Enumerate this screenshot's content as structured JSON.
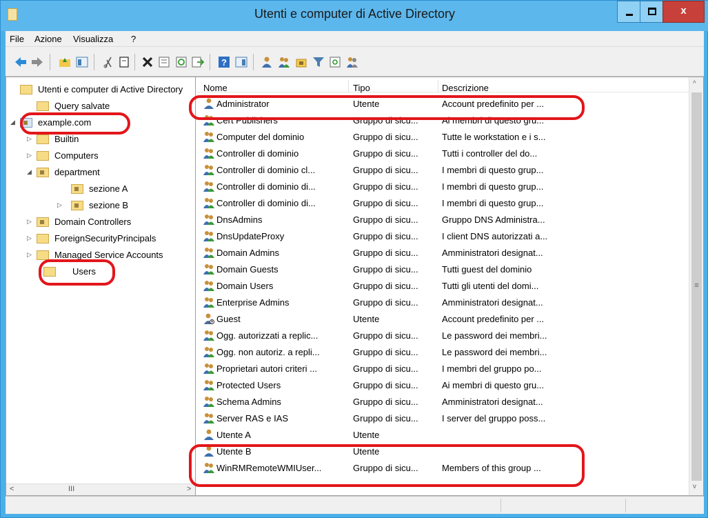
{
  "window": {
    "title": "Utenti e computer di Active Directory",
    "close_glyph": "x"
  },
  "menu": [
    "File",
    "Azione",
    "Visualizza",
    "?"
  ],
  "toolbar_icons": [
    "back-icon",
    "forward-icon",
    "up-folder-icon",
    "show-tree-icon",
    "cut-icon",
    "copy-icon",
    "delete-icon",
    "properties-icon",
    "refresh-icon",
    "export-icon",
    "help-icon",
    "console-icon",
    "new-user-icon",
    "new-group-icon",
    "new-ou-icon",
    "filter-icon",
    "find-icon",
    "add-to-group-icon"
  ],
  "tree": [
    {
      "label": "Utenti e computer di Active Directory",
      "level": 0,
      "expander": ""
    },
    {
      "label": "Query salvate",
      "level": 1,
      "expander": ""
    },
    {
      "label": "example.com",
      "level": 0,
      "expander": "◢"
    },
    {
      "label": "Builtin",
      "level": 1,
      "expander": "▷"
    },
    {
      "label": "Computers",
      "level": 1,
      "expander": "▷"
    },
    {
      "label": "department",
      "level": 1,
      "expander": "◢"
    },
    {
      "label": "sezione A",
      "level": 2,
      "expander": ""
    },
    {
      "label": "sezione B",
      "level": 2,
      "expander": "▷"
    },
    {
      "label": "Domain Controllers",
      "level": 1,
      "expander": "▷"
    },
    {
      "label": "ForeignSecurityPrincipals",
      "level": 1,
      "expander": "▷"
    },
    {
      "label": "Managed Service Accounts",
      "level": 1,
      "expander": "▷"
    },
    {
      "label": "Users",
      "level": 1,
      "expander": ""
    }
  ],
  "tree_scroll": {
    "left": "<",
    "grip": "III",
    "right": ">"
  },
  "list": {
    "columns": [
      "Nome",
      "Tipo",
      "Descrizione"
    ],
    "rows": [
      {
        "name": "Administrator",
        "type": "Utente",
        "desc": "Account predefinito per ...",
        "icon": "user"
      },
      {
        "name": "Cert Publishers",
        "type": "Gruppo di sicu...",
        "desc": "Ai membri di questo gru...",
        "icon": "group"
      },
      {
        "name": "Computer del dominio",
        "type": "Gruppo di sicu...",
        "desc": "Tutte le workstation e i s...",
        "icon": "group"
      },
      {
        "name": "Controller di dominio",
        "type": "Gruppo di sicu...",
        "desc": "Tutti i controller del do...",
        "icon": "group"
      },
      {
        "name": "Controller di dominio cl...",
        "type": "Gruppo di sicu...",
        "desc": "I membri di questo grup...",
        "icon": "group"
      },
      {
        "name": "Controller di dominio di...",
        "type": "Gruppo di sicu...",
        "desc": "I membri di questo grup...",
        "icon": "group"
      },
      {
        "name": "Controller di dominio di...",
        "type": "Gruppo di sicu...",
        "desc": "I membri di questo grup...",
        "icon": "group"
      },
      {
        "name": "DnsAdmins",
        "type": "Gruppo di sicu...",
        "desc": "Gruppo DNS Administra...",
        "icon": "group"
      },
      {
        "name": "DnsUpdateProxy",
        "type": "Gruppo di sicu...",
        "desc": "I client DNS autorizzati a...",
        "icon": "group"
      },
      {
        "name": "Domain Admins",
        "type": "Gruppo di sicu...",
        "desc": "Amministratori designat...",
        "icon": "group"
      },
      {
        "name": "Domain Guests",
        "type": "Gruppo di sicu...",
        "desc": "Tutti guest del dominio",
        "icon": "group"
      },
      {
        "name": "Domain Users",
        "type": "Gruppo di sicu...",
        "desc": "Tutti gli utenti del domi...",
        "icon": "group"
      },
      {
        "name": "Enterprise Admins",
        "type": "Gruppo di sicu...",
        "desc": "Amministratori designat...",
        "icon": "group"
      },
      {
        "name": "Guest",
        "type": "Utente",
        "desc": "Account predefinito per ...",
        "icon": "user-disabled"
      },
      {
        "name": "Ogg. autorizzati a replic...",
        "type": "Gruppo di sicu...",
        "desc": "Le password dei membri...",
        "icon": "group"
      },
      {
        "name": "Ogg. non autoriz. a repli...",
        "type": "Gruppo di sicu...",
        "desc": "Le password dei membri...",
        "icon": "group"
      },
      {
        "name": "Proprietari autori criteri ...",
        "type": "Gruppo di sicu...",
        "desc": "I membri del gruppo po...",
        "icon": "group"
      },
      {
        "name": "Protected Users",
        "type": "Gruppo di sicu...",
        "desc": "Ai membri di questo gru...",
        "icon": "group"
      },
      {
        "name": "Schema Admins",
        "type": "Gruppo di sicu...",
        "desc": "Amministratori designat...",
        "icon": "group"
      },
      {
        "name": "Server RAS e IAS",
        "type": "Gruppo di sicu...",
        "desc": "I server del gruppo poss...",
        "icon": "group"
      },
      {
        "name": "Utente A",
        "type": "Utente",
        "desc": "",
        "icon": "user"
      },
      {
        "name": "Utente B",
        "type": "Utente",
        "desc": "",
        "icon": "user"
      },
      {
        "name": "WinRMRemoteWMIUser...",
        "type": "Gruppo di sicu...",
        "desc": "Members of this group ...",
        "icon": "group"
      }
    ]
  },
  "scrollbar": {
    "up": "^",
    "grip": "≡",
    "down": "v"
  },
  "highlight_color": "#e2161b"
}
